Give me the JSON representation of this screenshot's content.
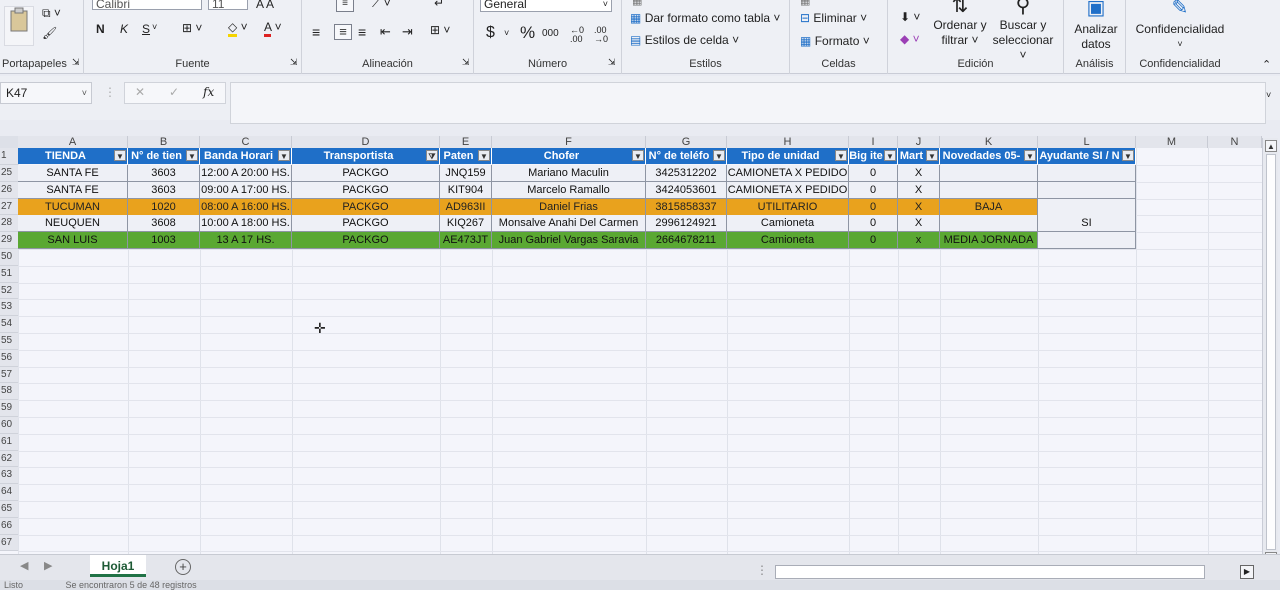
{
  "ribbon": {
    "font_name": "Calibri",
    "font_size": "11",
    "bold": "N",
    "italic": "K",
    "underline": "S",
    "number_format": "General",
    "currency": "$",
    "percent": "%",
    "thousands": "000",
    "dar_formato_tabla": "Dar formato como tabla ˅",
    "estilos_celda": "Estilos de celda ˅",
    "eliminar": "Eliminar ˅",
    "formato": "Formato ˅",
    "ordenar_line1": "Ordenar y",
    "ordenar_line2": "filtrar ˅",
    "buscar_line1": "Buscar y",
    "buscar_line2": "seleccionar ˅",
    "analizar_line1": "Analizar",
    "analizar_line2": "datos",
    "confidencialidad_btn": "Confidencialidad",
    "groups": {
      "portapapeles": "Portapapeles",
      "fuente": "Fuente",
      "alineacion": "Alineación",
      "numero": "Número",
      "estilos": "Estilos",
      "celdas": "Celdas",
      "edicion": "Edición",
      "analisis": "Análisis",
      "confidencialidad": "Confidencialidad"
    }
  },
  "formula_bar": {
    "name_box": "K47",
    "fx": "fx",
    "content": ""
  },
  "columns": [
    "A",
    "B",
    "C",
    "D",
    "E",
    "F",
    "G",
    "H",
    "I",
    "J",
    "K",
    "L",
    "M",
    "N"
  ],
  "table": {
    "headers": [
      "TIENDA",
      "N° de tien",
      "Banda Horari",
      "Transportista",
      "Paten",
      "Chofer",
      "N° de teléfo",
      "Tipo de unidad",
      "Big ite",
      "Mart",
      "Novedades 05-",
      "Ayudante SI / N"
    ],
    "header_row_number": "1",
    "rows": [
      {
        "row": "25",
        "cells": [
          "SANTA FE",
          "3603",
          "12:00 A 20:00 HS.",
          "PACKGO",
          "JNQ159",
          "Mariano Maculin",
          "3425312202",
          "CAMIONETA X PEDIDO",
          "0",
          "X",
          "",
          ""
        ]
      },
      {
        "row": "26",
        "cells": [
          "SANTA FE",
          "3603",
          "09:00 A 17:00 HS.",
          "PACKGO",
          "KIT904",
          "Marcelo Ramallo",
          "3424053601",
          "CAMIONETA X PEDIDO",
          "0",
          "X",
          "",
          ""
        ]
      },
      {
        "row": "27",
        "cells": [
          "TUCUMAN",
          "1020",
          "08:00 A 16:00 HS.",
          "PACKGO",
          "AD963II",
          "Daniel Frias",
          "3815858337",
          "UTILITARIO",
          "0",
          "X",
          "BAJA",
          ""
        ]
      },
      {
        "row": "28",
        "cells": [
          "NEUQUEN",
          "3608",
          "10:00 A 18:00 HS.",
          "PACKGO",
          "KIQ267",
          "Monsalve Anahi Del Carmen",
          "2996124921",
          "Camioneta",
          "0",
          "X",
          "",
          "SI"
        ]
      },
      {
        "row": "29",
        "cells": [
          "SAN LUIS",
          "1003",
          "13 A 17 HS.",
          "PACKGO",
          "AE473JT",
          "Juan Gabriel Vargas Saravia",
          "2664678211",
          "Camioneta",
          "0",
          "x",
          "MEDIA JORNADA",
          ""
        ]
      }
    ],
    "empty_rows": [
      "50",
      "51",
      "52",
      "53",
      "54",
      "55",
      "56",
      "57",
      "58",
      "59",
      "60",
      "61",
      "62",
      "63",
      "64",
      "65",
      "66",
      "67"
    ]
  },
  "colors": {
    "header_blue": "#1f6fc8",
    "row_orange": "#e9a21d",
    "row_green": "#5aa832",
    "accent_green": "#217346"
  },
  "sheet_tabs": [
    "Hoja1"
  ],
  "status": {
    "ready": "Listo",
    "records": "Se encontraron 5 de 48 registros"
  }
}
